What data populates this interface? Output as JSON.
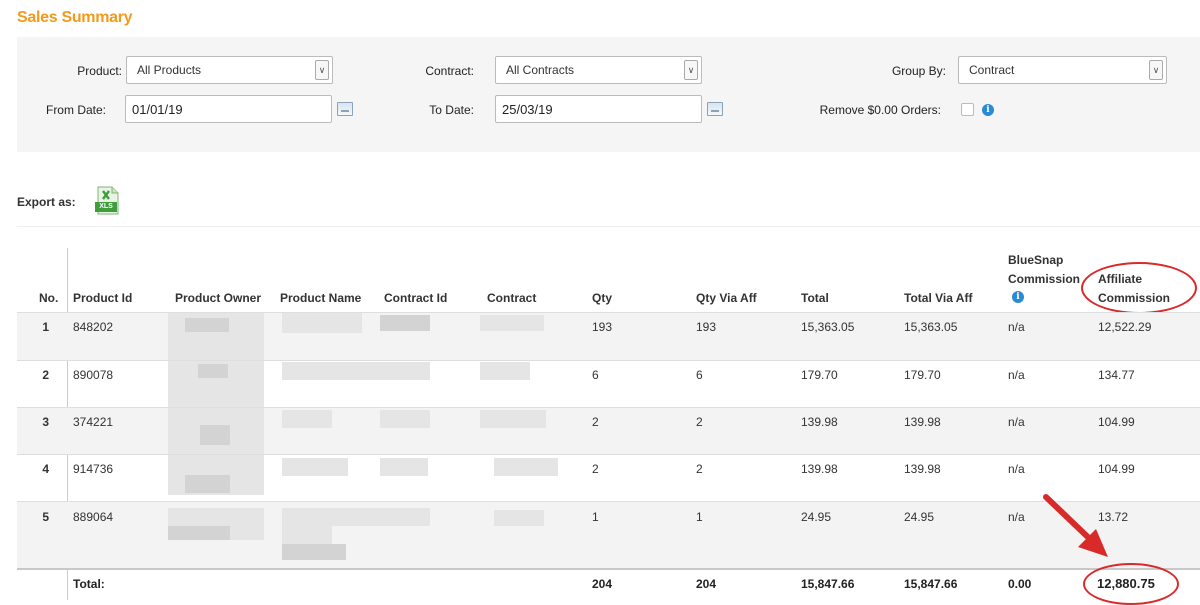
{
  "page": {
    "title": "Sales Summary"
  },
  "filters": {
    "product_label": "Product:",
    "product_value": "All Products",
    "contract_label": "Contract:",
    "contract_value": "All Contracts",
    "group_by_label": "Group By:",
    "group_by_value": "Contract",
    "from_date_label": "From Date:",
    "from_date_value": "01/01/19",
    "to_date_label": "To Date:",
    "to_date_value": "25/03/19",
    "remove_zero_label": "Remove $0.00 Orders:",
    "info_glyph": "i"
  },
  "export": {
    "label": "Export as:",
    "xls_text": "XLS"
  },
  "table": {
    "headers": {
      "no": "No.",
      "product_id": "Product Id",
      "product_owner": "Product Owner",
      "product_name": "Product Name",
      "contract_id": "Contract Id",
      "contract": "Contract",
      "qty": "Qty",
      "qty_via_aff": "Qty Via Aff",
      "total": "Total",
      "total_via_aff": "Total Via Aff",
      "bluesnap_commission_line1": "BlueSnap",
      "bluesnap_commission_line2": "Commission",
      "affiliate_commission_line1": "Affiliate",
      "affiliate_commission_line2": "Commission"
    },
    "rows": [
      {
        "no": "1",
        "product_id": "848202",
        "qty": "193",
        "qty_via_aff": "193",
        "total": "15,363.05",
        "total_via_aff": "15,363.05",
        "bluesnap_commission": "n/a",
        "affiliate_commission": "12,522.29"
      },
      {
        "no": "2",
        "product_id": "890078",
        "qty": "6",
        "qty_via_aff": "6",
        "total": "179.70",
        "total_via_aff": "179.70",
        "bluesnap_commission": "n/a",
        "affiliate_commission": "134.77"
      },
      {
        "no": "3",
        "product_id": "374221",
        "qty": "2",
        "qty_via_aff": "2",
        "total": "139.98",
        "total_via_aff": "139.98",
        "bluesnap_commission": "n/a",
        "affiliate_commission": "104.99"
      },
      {
        "no": "4",
        "product_id": "914736",
        "qty": "2",
        "qty_via_aff": "2",
        "total": "139.98",
        "total_via_aff": "139.98",
        "bluesnap_commission": "n/a",
        "affiliate_commission": "104.99"
      },
      {
        "no": "5",
        "product_id": "889064",
        "qty": "1",
        "qty_via_aff": "1",
        "total": "24.95",
        "total_via_aff": "24.95",
        "bluesnap_commission": "n/a",
        "affiliate_commission": "13.72"
      }
    ],
    "totals": {
      "label": "Total:",
      "qty": "204",
      "qty_via_aff": "204",
      "total": "15,847.66",
      "total_via_aff": "15,847.66",
      "bluesnap_commission": "0.00",
      "affiliate_commission": "12,880.75"
    }
  },
  "colors": {
    "title": "#f39a1d",
    "info": "#2a8ad4",
    "annotation": "#d92a2a",
    "xls": "#3f9d3a"
  }
}
